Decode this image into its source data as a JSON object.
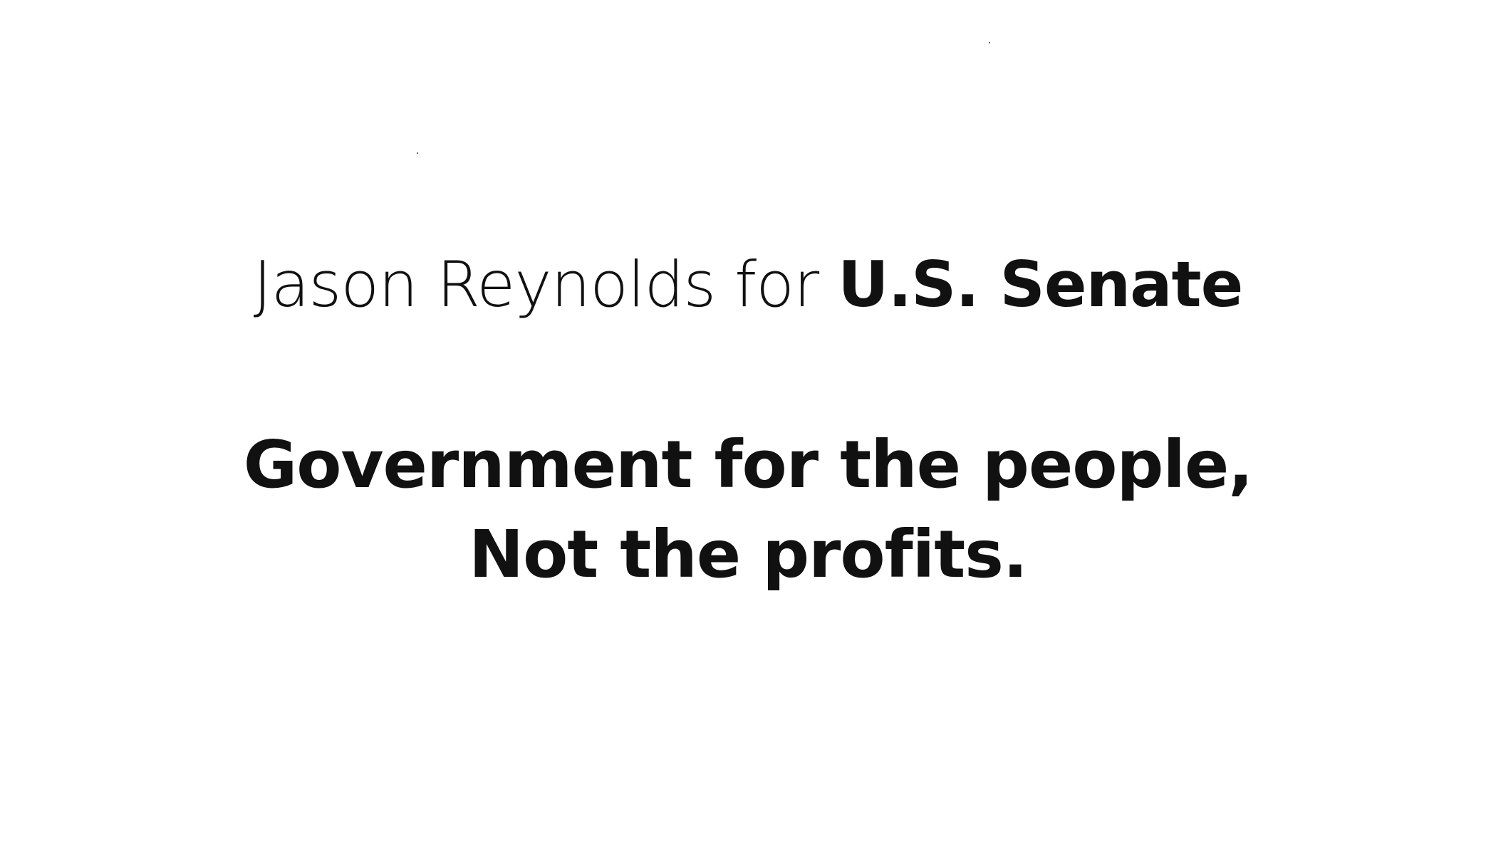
{
  "headline": {
    "name_part": "Jason Reynolds for",
    "office_part": "U.S. Senate"
  },
  "slogan": {
    "line1": "Government for the people,",
    "line2": "Not the profits."
  },
  "colors": {
    "background": "#ffffff",
    "text": "#111111"
  }
}
